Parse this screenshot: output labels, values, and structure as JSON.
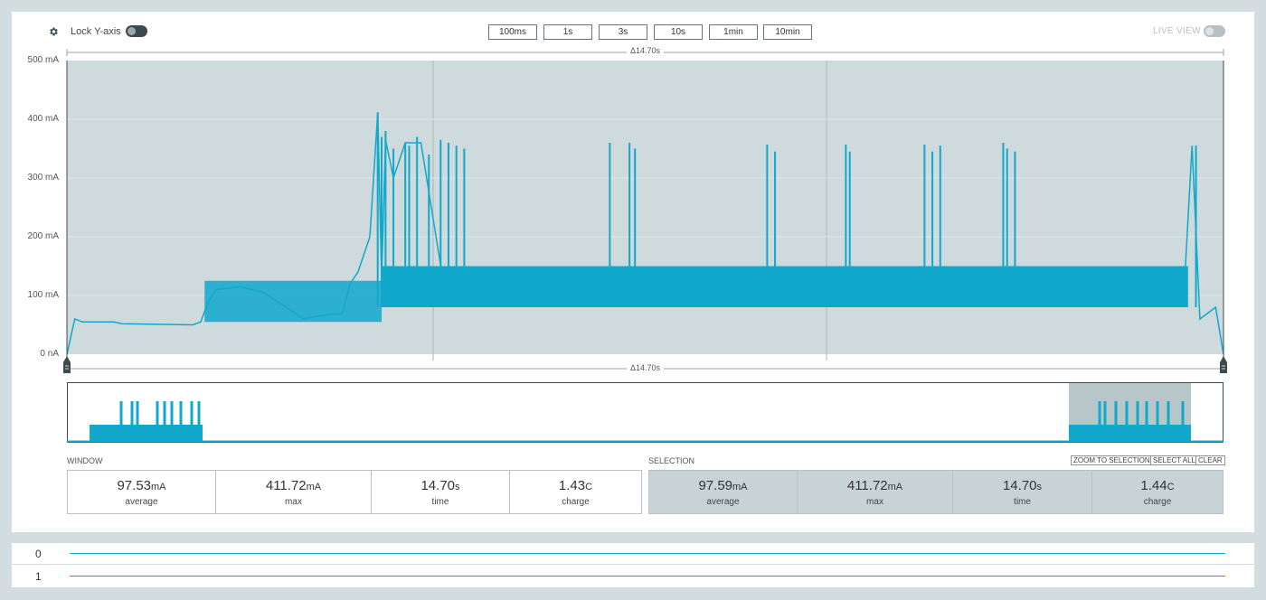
{
  "toolbar": {
    "gear_icon": "gear-icon",
    "lock_y_label": "Lock Y-axis",
    "lock_y_on": true,
    "window_buttons": [
      "100ms",
      "1s",
      "3s",
      "10s",
      "1min",
      "10min"
    ],
    "live_view_label": "LIVE VIEW",
    "live_view_on": false
  },
  "chart": {
    "y_ticks": [
      "500 mA",
      "400 mA",
      "300 mA",
      "200 mA",
      "100 mA",
      "0 nA"
    ],
    "delta_top": "Δ14.70s",
    "delta_bottom": "Δ14.70s"
  },
  "window": {
    "title": "WINDOW",
    "average_value": "97.53",
    "average_unit": "mA",
    "average_label": "average",
    "max_value": "411.72",
    "max_unit": "mA",
    "max_label": "max",
    "time_value": "14.70",
    "time_unit": "s",
    "time_label": "time",
    "charge_value": "1.43",
    "charge_unit": "C",
    "charge_label": "charge"
  },
  "selection": {
    "title": "SELECTION",
    "zoom_label": "ZOOM TO SELECTION",
    "select_all_label": "SELECT ALL",
    "clear_label": "CLEAR",
    "average_value": "97.59",
    "average_unit": "mA",
    "average_label": "average",
    "max_value": "411.72",
    "max_unit": "mA",
    "max_label": "max",
    "time_value": "14.70",
    "time_unit": "s",
    "time_label": "time",
    "charge_value": "1.44",
    "charge_unit": "C",
    "charge_label": "charge"
  },
  "digital_channels": [
    "0",
    "1"
  ],
  "colors": {
    "trace": "#11a8cc",
    "plot_bg": "#cfdadc",
    "selection_bg": "#c7d3d6"
  },
  "chart_data": {
    "type": "line",
    "xlabel": "",
    "ylabel": "",
    "ylim": [
      0,
      500
    ],
    "y_unit": "mA",
    "x_range_s": [
      0,
      14.7
    ],
    "grid": true,
    "series": [
      {
        "x": [
          0.0,
          0.1,
          0.2,
          0.6,
          0.7,
          1.6,
          1.7,
          1.8,
          1.9,
          2.2,
          2.5,
          2.9,
          3.0,
          3.2,
          3.5,
          3.6,
          3.7,
          3.85,
          3.95,
          4.0,
          4.05,
          4.15,
          4.3,
          4.5,
          4.8,
          6.0,
          7.0,
          8.0,
          9.0,
          10.0,
          11.0,
          12.0,
          13.0,
          14.2,
          14.3,
          14.4,
          14.5,
          14.6,
          14.7
        ],
        "y": [
          0,
          60,
          55,
          55,
          52,
          50,
          55,
          90,
          110,
          115,
          105,
          70,
          60,
          65,
          70,
          120,
          140,
          200,
          411.72,
          130,
          365,
          300,
          360,
          360,
          110,
          110,
          110,
          110,
          110,
          110,
          110,
          110,
          110,
          110,
          355,
          60,
          70,
          80,
          0
        ]
      }
    ]
  }
}
